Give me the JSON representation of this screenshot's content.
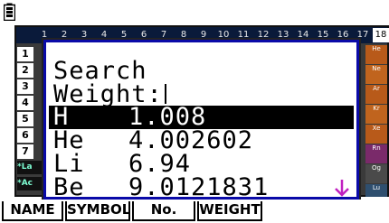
{
  "periodic_table": {
    "groups": [
      "1",
      "2",
      "3",
      "4",
      "5",
      "6",
      "7",
      "8",
      "9",
      "10",
      "11",
      "12",
      "13",
      "14",
      "15",
      "16",
      "17",
      "18"
    ],
    "periods": [
      "1",
      "2",
      "3",
      "4",
      "5",
      "6",
      "7"
    ],
    "side_elements": [
      "He",
      "Ne",
      "Ar",
      "Kr",
      "Xe",
      "Rn",
      "Og",
      "Lu",
      "Lr"
    ],
    "legend": [
      "*La",
      "*Ac"
    ]
  },
  "dialog": {
    "title": "Search",
    "search_label": "Weight:",
    "search_value": "",
    "results": [
      {
        "symbol": "H",
        "weight": "1.008"
      },
      {
        "symbol": "He",
        "weight": "4.002602"
      },
      {
        "symbol": "Li",
        "weight": "6.94"
      },
      {
        "symbol": "Be",
        "weight": "9.0121831"
      }
    ]
  },
  "function_keys": [
    "NAME",
    "SYMBOL",
    "No.",
    "WEIGHT"
  ],
  "colors": {
    "dialog_border": "#0a0aa8",
    "selection_bg": "#000000",
    "scroll_arrow": "#c020c0"
  }
}
